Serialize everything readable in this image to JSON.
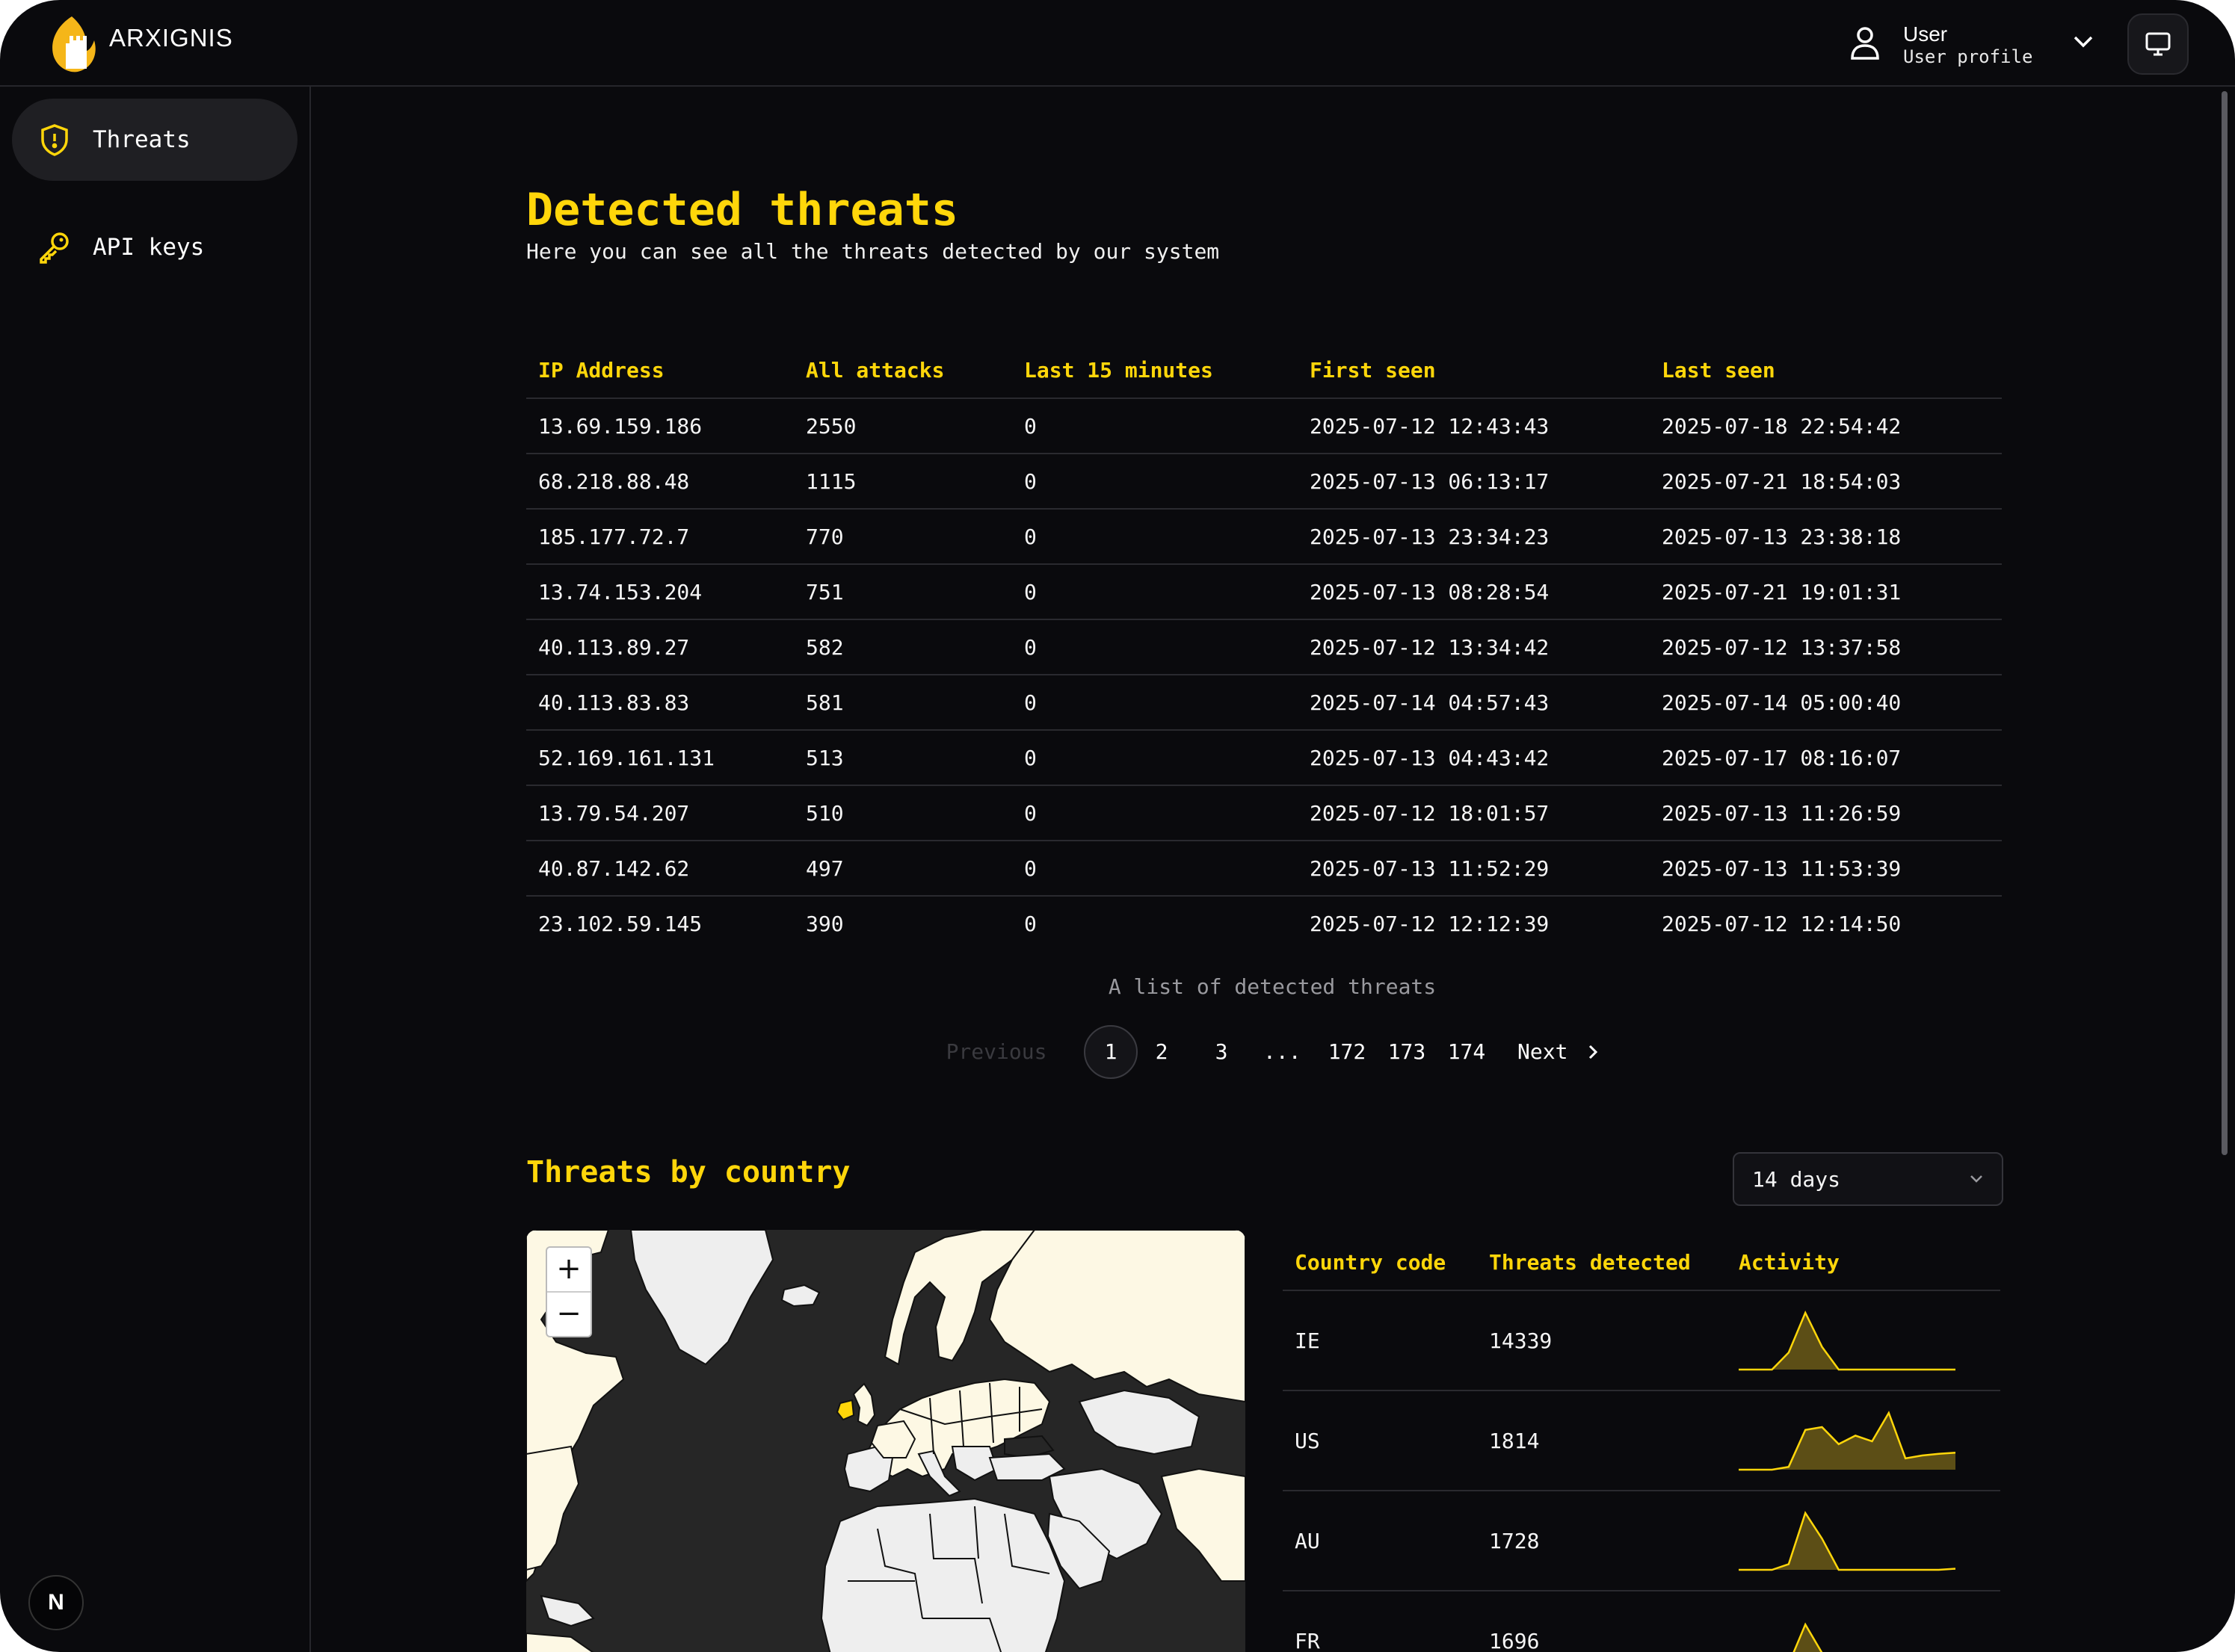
{
  "app": {
    "brand": "ARXIGNIS"
  },
  "user": {
    "name": "User",
    "subtitle": "User profile"
  },
  "sidebar": {
    "items": [
      {
        "label": "Threats",
        "active": true
      },
      {
        "label": "API keys",
        "active": false
      }
    ],
    "badge": "N"
  },
  "page": {
    "title": "Detected threats",
    "subtitle": "Here you can see all the threats detected by our system"
  },
  "threats_table": {
    "columns": [
      "IP Address",
      "All attacks",
      "Last 15 minutes",
      "First seen",
      "Last seen"
    ],
    "rows": [
      [
        "13.69.159.186",
        "2550",
        "0",
        "2025-07-12 12:43:43",
        "2025-07-18 22:54:42"
      ],
      [
        "68.218.88.48",
        "1115",
        "0",
        "2025-07-13 06:13:17",
        "2025-07-21 18:54:03"
      ],
      [
        "185.177.72.7",
        "770",
        "0",
        "2025-07-13 23:34:23",
        "2025-07-13 23:38:18"
      ],
      [
        "13.74.153.204",
        "751",
        "0",
        "2025-07-13 08:28:54",
        "2025-07-21 19:01:31"
      ],
      [
        "40.113.89.27",
        "582",
        "0",
        "2025-07-12 13:34:42",
        "2025-07-12 13:37:58"
      ],
      [
        "40.113.83.83",
        "581",
        "0",
        "2025-07-14 04:57:43",
        "2025-07-14 05:00:40"
      ],
      [
        "52.169.161.131",
        "513",
        "0",
        "2025-07-13 04:43:42",
        "2025-07-17 08:16:07"
      ],
      [
        "13.79.54.207",
        "510",
        "0",
        "2025-07-12 18:01:57",
        "2025-07-13 11:26:59"
      ],
      [
        "40.87.142.62",
        "497",
        "0",
        "2025-07-13 11:52:29",
        "2025-07-13 11:53:39"
      ],
      [
        "23.102.59.145",
        "390",
        "0",
        "2025-07-12 12:12:39",
        "2025-07-12 12:14:50"
      ]
    ],
    "caption": "A list of detected threats"
  },
  "pagination": {
    "previous_label": "Previous",
    "pages": [
      "1",
      "2",
      "3",
      "...",
      "172",
      "173",
      "174"
    ],
    "current": "1",
    "next_label": "Next"
  },
  "country_section": {
    "title": "Threats by country",
    "range_selected": "14 days",
    "columns": [
      "Country code",
      "Threats detected",
      "Activity"
    ],
    "rows": [
      {
        "code": "IE",
        "count": "14339",
        "activity": [
          0,
          0,
          0,
          0.3,
          1,
          0.4,
          0,
          0,
          0,
          0,
          0,
          0,
          0,
          0
        ]
      },
      {
        "code": "US",
        "count": "1814",
        "activity": [
          0,
          0,
          0,
          0.05,
          0.7,
          0.75,
          0.45,
          0.6,
          0.5,
          1,
          0.2,
          0.25,
          0.28,
          0.3
        ]
      },
      {
        "code": "AU",
        "count": "1728",
        "activity": [
          0,
          0,
          0,
          0.1,
          1,
          0.55,
          0,
          0,
          0,
          0,
          0,
          0,
          0,
          0.02
        ]
      },
      {
        "code": "FR",
        "count": "1696",
        "activity": [
          0,
          0,
          0,
          0.1,
          0.8,
          0.3,
          0,
          0,
          0,
          0,
          0,
          0,
          0,
          0
        ]
      }
    ]
  },
  "colors": {
    "accent": "#ffd60a",
    "background": "#0a0a0d",
    "border": "#2a2a2f",
    "spark_fill": "#5c4e16"
  },
  "icons": {
    "logo": "flame-castle-logo",
    "user": "user-icon",
    "chevron": "chevron-down-icon",
    "monitor": "monitor-icon",
    "threats": "shield-alert-icon",
    "api": "key-icon"
  }
}
